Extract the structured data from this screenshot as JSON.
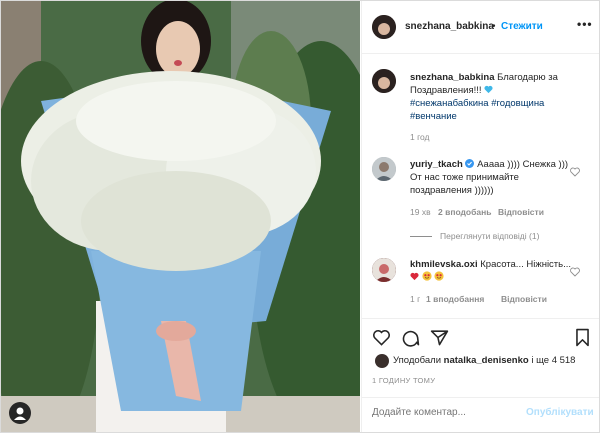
{
  "post": {
    "username": "snezhana_babkina",
    "dot": "•",
    "follow_label": "Стежити",
    "more_label": "•••",
    "caption_text": "Благодарю за Поздравления!!!",
    "hashtags": "#снежанабабкина #годовщина #венчание",
    "caption_time": "1 год"
  },
  "comments": [
    {
      "username": "yuriy_tkach",
      "text": "Ааааа )))) Снежка ))) От нас тоже принимайте поздравления ))))))",
      "time": "19 хв",
      "likes": "2 вподобань",
      "reply": "Відповісти",
      "view_replies": "Переглянути відповіді (1)"
    },
    {
      "username": "khmilevska.oxi",
      "text": "Красота... Ніжність...",
      "time": "1 г",
      "likes": "1 вподобання",
      "reply": "Відповісти"
    }
  ],
  "likes": {
    "prefix": "Уподобали",
    "user": "natalka_denisenko",
    "suffix": "і ще 4 518"
  },
  "timestamp": "1 ГОДИНУ ТОМУ",
  "comment_box": {
    "placeholder": "Додайте коментар...",
    "post_label": "Опублікувати"
  },
  "colors": {
    "link_blue": "#0095f6",
    "hashtag": "#00376b",
    "muted": "#8e8e8e",
    "verified": "#3897f0"
  }
}
